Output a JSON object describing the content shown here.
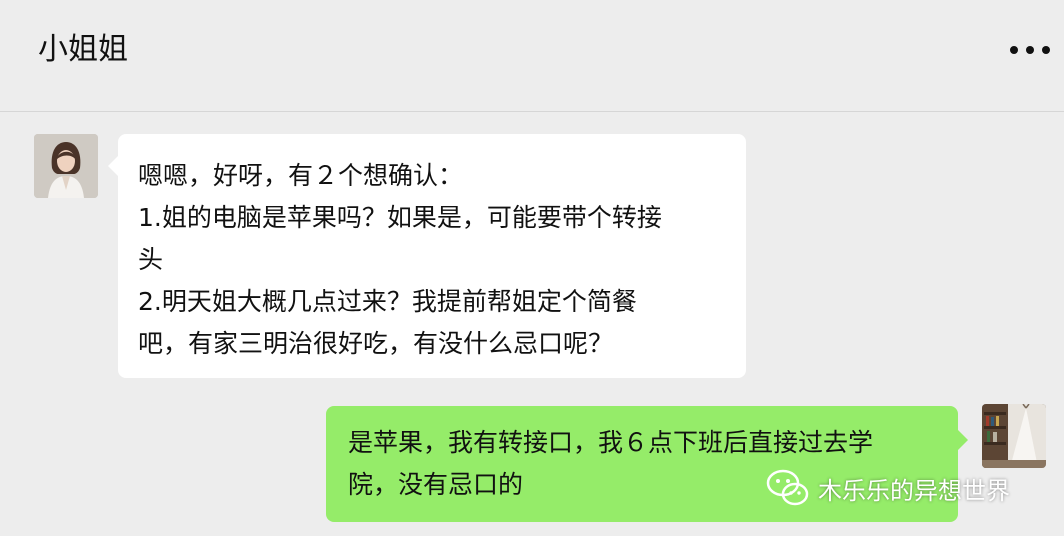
{
  "header": {
    "title": "小姐姐",
    "more_icon": "more-dots-icon"
  },
  "messages": [
    {
      "direction": "incoming",
      "lines": [
        "嗯嗯，好呀，有２个想确认：",
        "1.姐的电脑是苹果吗？如果是，可能要带个转接",
        "头",
        "2.明天姐大概几点过来？我提前帮姐定个简餐",
        "吧，有家三明治很好吃，有没什么忌口呢？"
      ]
    },
    {
      "direction": "outgoing",
      "lines": [
        "是苹果，我有转接口，我６点下班后直接过去学",
        "院，没有忌口的"
      ]
    }
  ],
  "watermark": {
    "text": "木乐乐的异想世界",
    "icon": "wechat-icon"
  },
  "colors": {
    "background": "#ededed",
    "incoming_bubble": "#ffffff",
    "outgoing_bubble": "#95ec69"
  }
}
